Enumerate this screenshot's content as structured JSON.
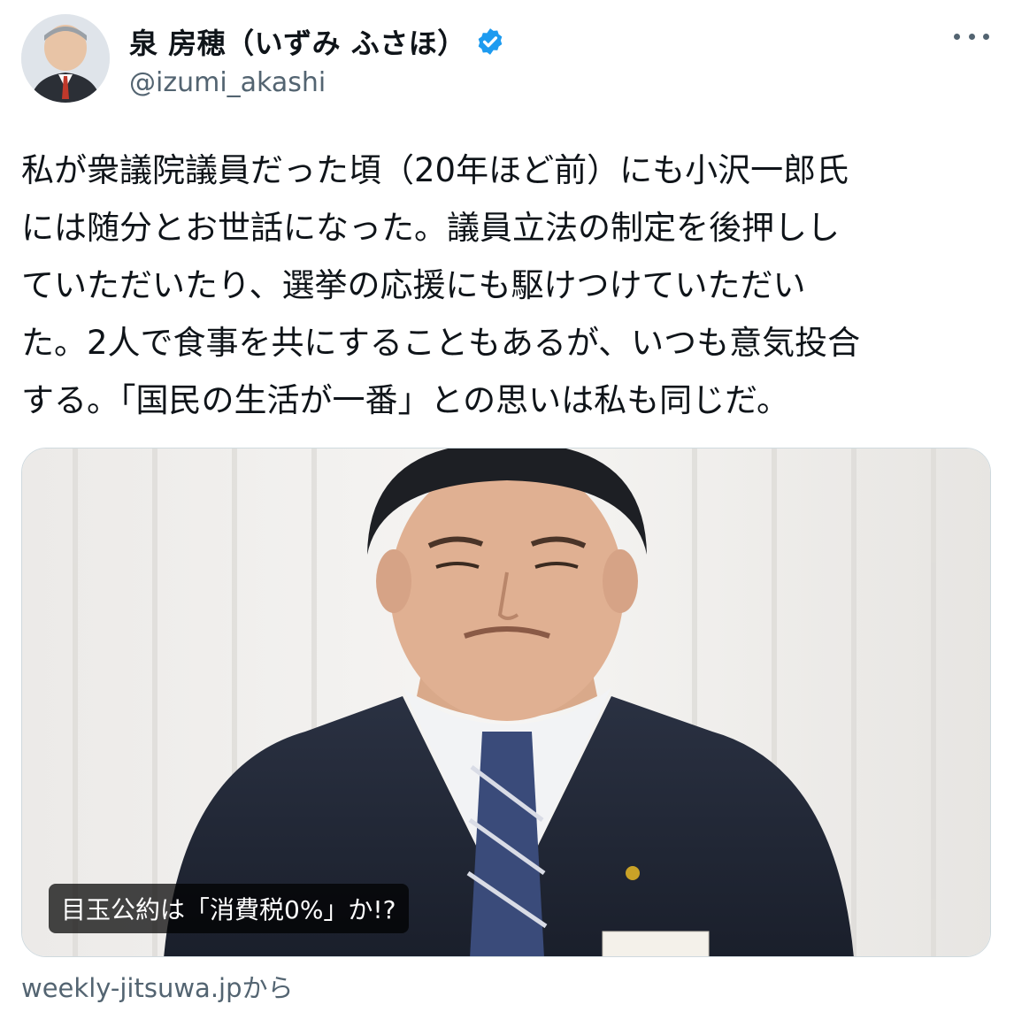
{
  "author": {
    "display_name": "泉 房穂（いずみ ふさほ）",
    "handle": "@izumi_akashi",
    "verified_icon": "verified-badge-icon",
    "verified_color": "#1d9bf0"
  },
  "menu": {
    "icon": "more-options-icon"
  },
  "tweet": {
    "text": "私が衆議院議員だった頃（20年ほど前）にも小沢一郎氏\nには随分とお世話になった。議員立法の制定を後押しし\nていただいたり、選挙の応援にも駆けつけていただい\nた。2人で食事を共にすることもあるが、いつも意気投合\nする。「国民の生活が一番」との思いは私も同じだ。"
  },
  "card": {
    "title": "目玉公約は「消費税0%」か!?",
    "source": "weekly-jitsuwa.jpから"
  },
  "colors": {
    "text_primary": "#0f1419",
    "text_secondary": "#536471",
    "accent": "#1d9bf0"
  }
}
